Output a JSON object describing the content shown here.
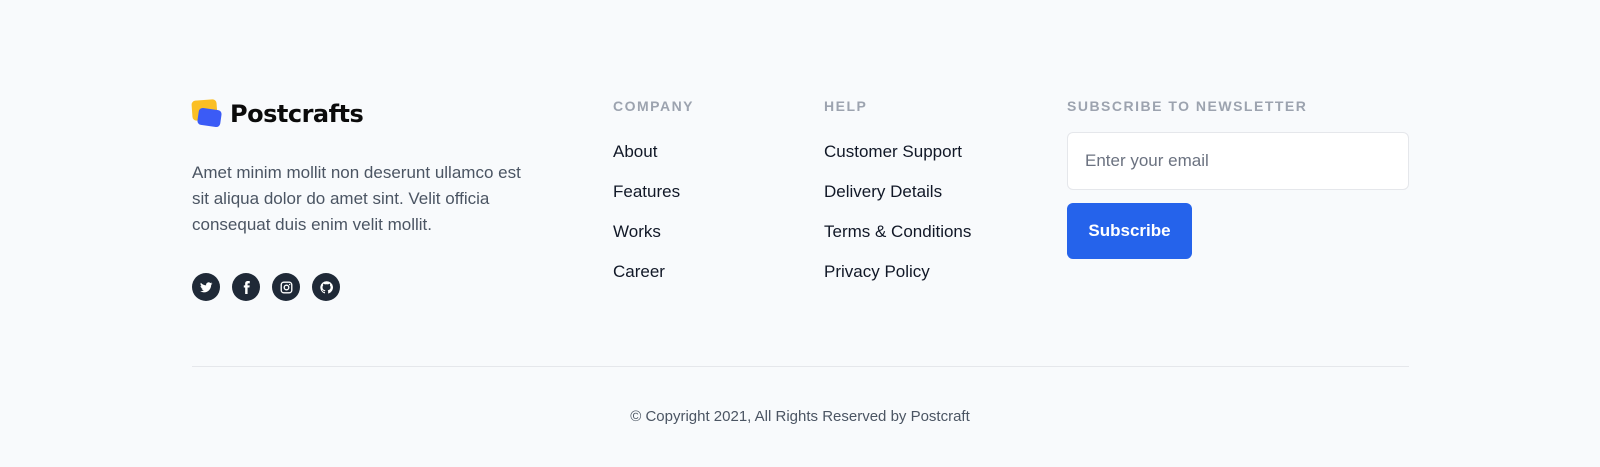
{
  "brand": {
    "name": "Postcrafts",
    "description": "Amet minim mollit non deserunt ullamco est sit aliqua dolor do amet sint. Velit officia consequat duis enim velit mollit.",
    "logo_colors": {
      "back": "#fbbf24",
      "front": "#3b5bf6"
    },
    "socials": [
      {
        "icon": "twitter-icon"
      },
      {
        "icon": "facebook-icon"
      },
      {
        "icon": "instagram-icon"
      },
      {
        "icon": "github-icon"
      }
    ]
  },
  "company": {
    "heading": "COMPANY",
    "links": [
      "About",
      "Features",
      "Works",
      "Career"
    ]
  },
  "help": {
    "heading": "HELP",
    "links": [
      "Customer Support",
      "Delivery Details",
      "Terms & Conditions",
      "Privacy Policy"
    ]
  },
  "newsletter": {
    "heading": "SUBSCRIBE TO NEWSLETTER",
    "placeholder": "Enter your email",
    "value": "",
    "button_label": "Subscribe",
    "button_color": "#2563eb"
  },
  "copyright": "© Copyright 2021, All Rights Reserved by Postcraft"
}
